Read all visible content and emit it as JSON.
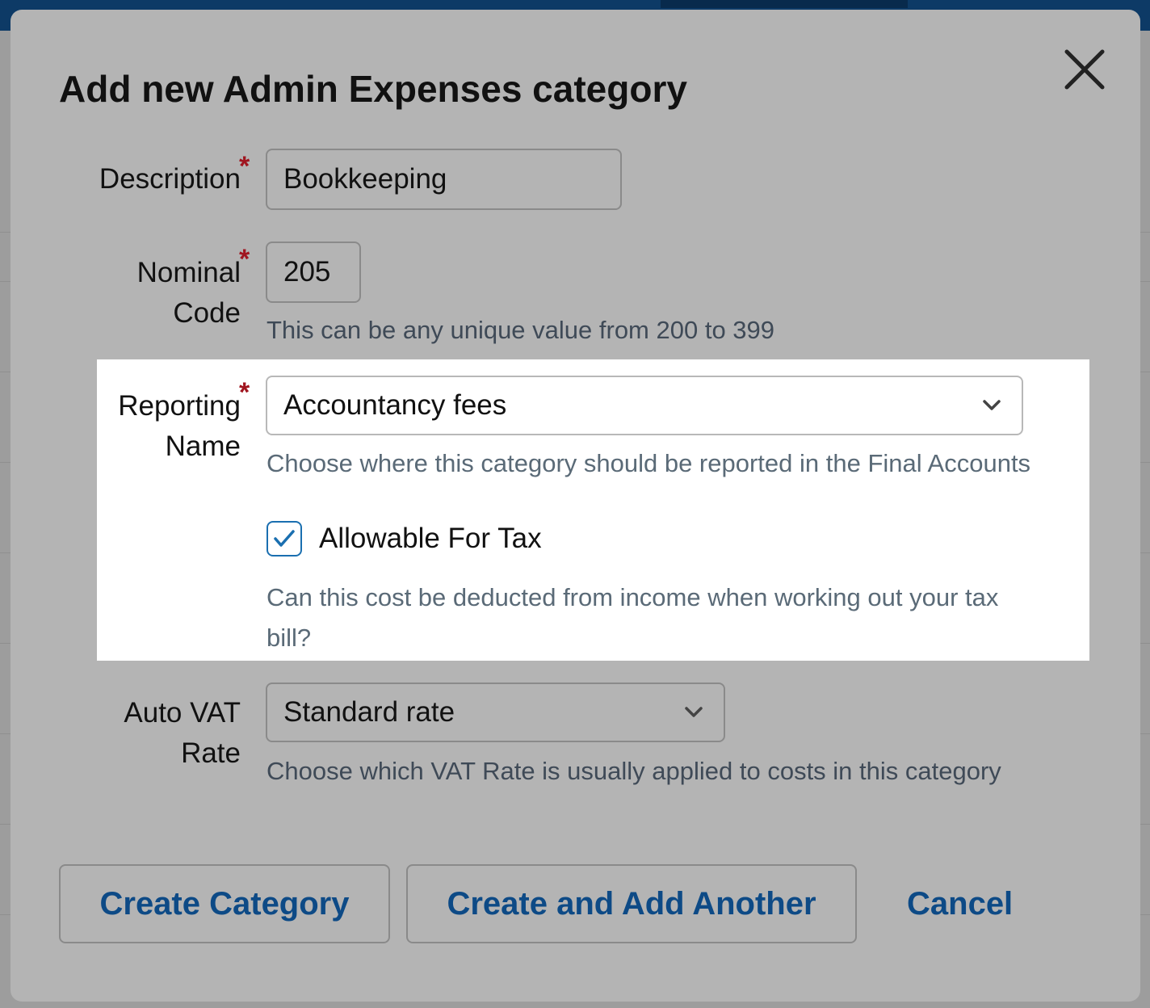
{
  "modal": {
    "title": "Add new Admin Expenses category",
    "close_icon": "close-icon"
  },
  "fields": {
    "description": {
      "label": "Description",
      "required_mark": "*",
      "value": "Bookkeeping"
    },
    "nominal_code": {
      "label_line1": "Nominal",
      "label_line2": "Code",
      "required_mark": "*",
      "value": "205",
      "help": "This can be any unique value from 200 to 399"
    },
    "reporting_name": {
      "label_line1": "Reporting",
      "label_line2": "Name",
      "required_mark": "*",
      "selected": "Accountancy fees",
      "help": "Choose where this category should be reported in the Final Accounts"
    },
    "allowable_for_tax": {
      "label": "Allowable For Tax",
      "checked": true,
      "help_line1": "Can this cost be deducted from income when working out your tax",
      "help_line2": "bill?"
    },
    "auto_vat_rate": {
      "label_line1": "Auto VAT",
      "label_line2": "Rate",
      "selected": "Standard rate",
      "help": "Choose which VAT Rate is usually applied to costs in this category"
    }
  },
  "actions": {
    "create": "Create Category",
    "create_another": "Create and Add Another",
    "cancel": "Cancel"
  },
  "colors": {
    "accent": "#0d4a86",
    "required": "#a0151f",
    "checkbox": "#1a6fb0",
    "overlay": "#b4b4b4",
    "highlight": "#ffffff"
  }
}
